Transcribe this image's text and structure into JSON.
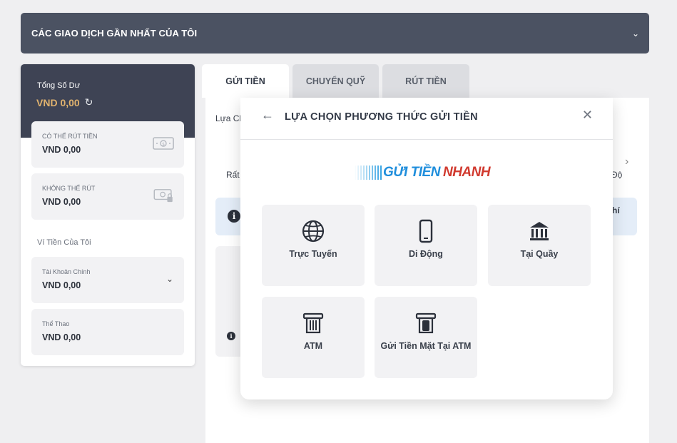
{
  "header": {
    "title": "CÁC GIAO DỊCH GẦN NHẤT CỦA TÔI",
    "chevron_icon": "chevron-down-icon"
  },
  "balance": {
    "total_label": "Tổng Số Dư",
    "total_amount": "VND  0,00",
    "withdrawable": {
      "label": "CÓ THỂ RÚT TIỀN",
      "amount": "VND  0,00"
    },
    "non_withdrawable": {
      "label": "KHÔNG THỂ RÚT",
      "amount": "VND  0,00"
    },
    "wallet_title": "Ví Tiền Của Tôi",
    "wallets": [
      {
        "label": "Tài Khoản Chính",
        "amount": "VND  0,00"
      },
      {
        "label": "Thể Thao",
        "amount": "VND  0,00"
      }
    ]
  },
  "tabs": [
    {
      "label": "GỬI TIỀN",
      "active": true
    },
    {
      "label": "CHUYỂN QUỸ",
      "active": false
    },
    {
      "label": "RÚT TIỀN",
      "active": false
    }
  ],
  "background": {
    "line1": "Lựa Ch",
    "line2": "Rất",
    "line3": "Độ",
    "line4": "hí"
  },
  "modal": {
    "title": "LỰA CHỌN PHƯƠNG THỨC GỬI TIỀN",
    "brand_part1": "GỬI TIỀN",
    "brand_part2": "NHANH",
    "methods": [
      {
        "label": "Trực Tuyến",
        "icon": "globe-icon"
      },
      {
        "label": "Di Động",
        "icon": "mobile-phone-icon"
      },
      {
        "label": "Tại Quầy",
        "icon": "bank-icon"
      },
      {
        "label": "ATM",
        "icon": "atm-icon"
      },
      {
        "label": "Gửi Tiền Mặt Tại ATM",
        "icon": "atm-cash-icon"
      }
    ]
  },
  "colors": {
    "header_bg": "#4b5262",
    "balance_bg": "#3e4354",
    "amount_gold": "#e0b26e",
    "brand_blue": "#1f8edc",
    "brand_red": "#d13a2f"
  }
}
